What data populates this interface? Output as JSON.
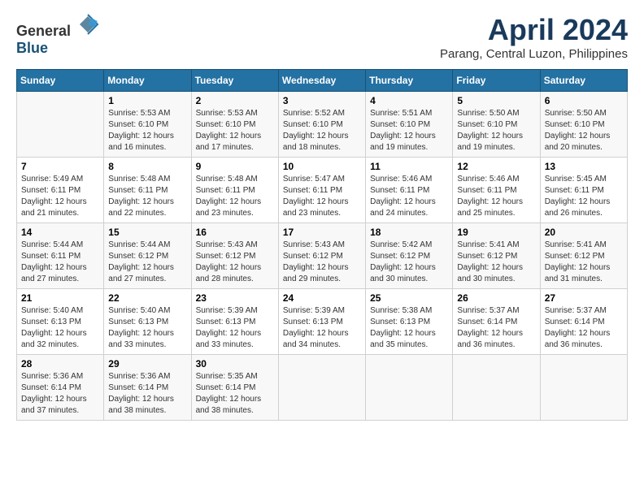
{
  "logo": {
    "text_general": "General",
    "text_blue": "Blue"
  },
  "title": {
    "month": "April 2024",
    "location": "Parang, Central Luzon, Philippines"
  },
  "calendar": {
    "headers": [
      "Sunday",
      "Monday",
      "Tuesday",
      "Wednesday",
      "Thursday",
      "Friday",
      "Saturday"
    ],
    "weeks": [
      [
        {
          "day": "",
          "info": ""
        },
        {
          "day": "1",
          "info": "Sunrise: 5:53 AM\nSunset: 6:10 PM\nDaylight: 12 hours\nand 16 minutes."
        },
        {
          "day": "2",
          "info": "Sunrise: 5:53 AM\nSunset: 6:10 PM\nDaylight: 12 hours\nand 17 minutes."
        },
        {
          "day": "3",
          "info": "Sunrise: 5:52 AM\nSunset: 6:10 PM\nDaylight: 12 hours\nand 18 minutes."
        },
        {
          "day": "4",
          "info": "Sunrise: 5:51 AM\nSunset: 6:10 PM\nDaylight: 12 hours\nand 19 minutes."
        },
        {
          "day": "5",
          "info": "Sunrise: 5:50 AM\nSunset: 6:10 PM\nDaylight: 12 hours\nand 19 minutes."
        },
        {
          "day": "6",
          "info": "Sunrise: 5:50 AM\nSunset: 6:10 PM\nDaylight: 12 hours\nand 20 minutes."
        }
      ],
      [
        {
          "day": "7",
          "info": "Sunrise: 5:49 AM\nSunset: 6:11 PM\nDaylight: 12 hours\nand 21 minutes."
        },
        {
          "day": "8",
          "info": "Sunrise: 5:48 AM\nSunset: 6:11 PM\nDaylight: 12 hours\nand 22 minutes."
        },
        {
          "day": "9",
          "info": "Sunrise: 5:48 AM\nSunset: 6:11 PM\nDaylight: 12 hours\nand 23 minutes."
        },
        {
          "day": "10",
          "info": "Sunrise: 5:47 AM\nSunset: 6:11 PM\nDaylight: 12 hours\nand 23 minutes."
        },
        {
          "day": "11",
          "info": "Sunrise: 5:46 AM\nSunset: 6:11 PM\nDaylight: 12 hours\nand 24 minutes."
        },
        {
          "day": "12",
          "info": "Sunrise: 5:46 AM\nSunset: 6:11 PM\nDaylight: 12 hours\nand 25 minutes."
        },
        {
          "day": "13",
          "info": "Sunrise: 5:45 AM\nSunset: 6:11 PM\nDaylight: 12 hours\nand 26 minutes."
        }
      ],
      [
        {
          "day": "14",
          "info": "Sunrise: 5:44 AM\nSunset: 6:11 PM\nDaylight: 12 hours\nand 27 minutes."
        },
        {
          "day": "15",
          "info": "Sunrise: 5:44 AM\nSunset: 6:12 PM\nDaylight: 12 hours\nand 27 minutes."
        },
        {
          "day": "16",
          "info": "Sunrise: 5:43 AM\nSunset: 6:12 PM\nDaylight: 12 hours\nand 28 minutes."
        },
        {
          "day": "17",
          "info": "Sunrise: 5:43 AM\nSunset: 6:12 PM\nDaylight: 12 hours\nand 29 minutes."
        },
        {
          "day": "18",
          "info": "Sunrise: 5:42 AM\nSunset: 6:12 PM\nDaylight: 12 hours\nand 30 minutes."
        },
        {
          "day": "19",
          "info": "Sunrise: 5:41 AM\nSunset: 6:12 PM\nDaylight: 12 hours\nand 30 minutes."
        },
        {
          "day": "20",
          "info": "Sunrise: 5:41 AM\nSunset: 6:12 PM\nDaylight: 12 hours\nand 31 minutes."
        }
      ],
      [
        {
          "day": "21",
          "info": "Sunrise: 5:40 AM\nSunset: 6:13 PM\nDaylight: 12 hours\nand 32 minutes."
        },
        {
          "day": "22",
          "info": "Sunrise: 5:40 AM\nSunset: 6:13 PM\nDaylight: 12 hours\nand 33 minutes."
        },
        {
          "day": "23",
          "info": "Sunrise: 5:39 AM\nSunset: 6:13 PM\nDaylight: 12 hours\nand 33 minutes."
        },
        {
          "day": "24",
          "info": "Sunrise: 5:39 AM\nSunset: 6:13 PM\nDaylight: 12 hours\nand 34 minutes."
        },
        {
          "day": "25",
          "info": "Sunrise: 5:38 AM\nSunset: 6:13 PM\nDaylight: 12 hours\nand 35 minutes."
        },
        {
          "day": "26",
          "info": "Sunrise: 5:37 AM\nSunset: 6:14 PM\nDaylight: 12 hours\nand 36 minutes."
        },
        {
          "day": "27",
          "info": "Sunrise: 5:37 AM\nSunset: 6:14 PM\nDaylight: 12 hours\nand 36 minutes."
        }
      ],
      [
        {
          "day": "28",
          "info": "Sunrise: 5:36 AM\nSunset: 6:14 PM\nDaylight: 12 hours\nand 37 minutes."
        },
        {
          "day": "29",
          "info": "Sunrise: 5:36 AM\nSunset: 6:14 PM\nDaylight: 12 hours\nand 38 minutes."
        },
        {
          "day": "30",
          "info": "Sunrise: 5:35 AM\nSunset: 6:14 PM\nDaylight: 12 hours\nand 38 minutes."
        },
        {
          "day": "",
          "info": ""
        },
        {
          "day": "",
          "info": ""
        },
        {
          "day": "",
          "info": ""
        },
        {
          "day": "",
          "info": ""
        }
      ]
    ]
  }
}
